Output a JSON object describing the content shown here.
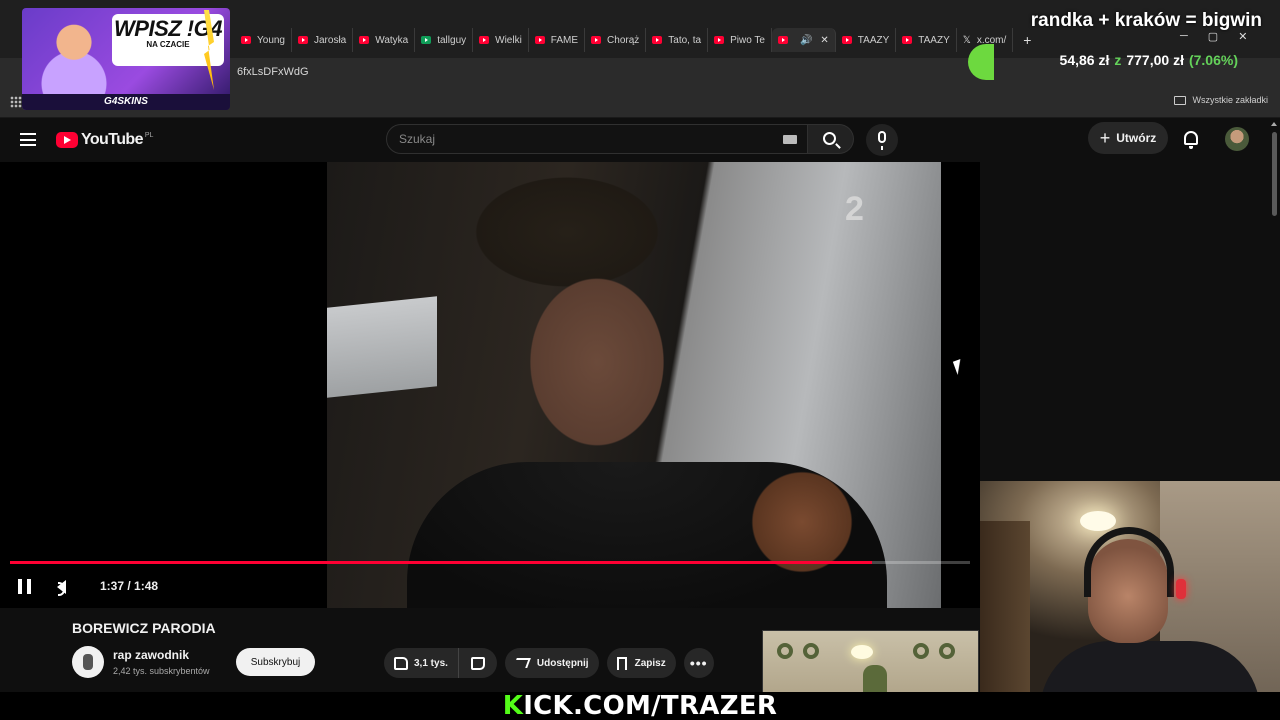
{
  "browser": {
    "tabs": [
      {
        "label": "Young",
        "icon": "youtube-icon"
      },
      {
        "label": "Jarosła",
        "icon": "youtube-icon"
      },
      {
        "label": "Watyka",
        "icon": "youtube-icon"
      },
      {
        "label": "tallguy",
        "icon": "sheets-icon"
      },
      {
        "label": "Wielki",
        "icon": "youtube-icon"
      },
      {
        "label": "FAME",
        "icon": "youtube-icon"
      },
      {
        "label": "Chorąż",
        "icon": "youtube-icon"
      },
      {
        "label": "Tato, ta",
        "icon": "youtube-icon"
      },
      {
        "label": "Piwo Te",
        "icon": "youtube-icon"
      },
      {
        "label": "",
        "icon": "youtube-icon",
        "active": true
      },
      {
        "label": "TAAZY",
        "icon": "youtube-icon"
      },
      {
        "label": "TAAZY",
        "icon": "youtube-icon"
      },
      {
        "label": "x.com/",
        "icon": "x-icon"
      }
    ],
    "url_fragment": "6fxLsDFxWdG",
    "all_bookmarks": "Wszystkie zakładki"
  },
  "promo": {
    "title": "WPISZ !G4",
    "subtitle": "NA CZACIE",
    "brand": "G4SKINS"
  },
  "donation": {
    "title": "randka + kraków = bigwin",
    "current": "54,86 zł",
    "separator": "z",
    "goal": "777,00 zł",
    "percent": "(7.06%)"
  },
  "youtube": {
    "logo_text": "YouTube",
    "region": "PL",
    "search_placeholder": "Szukaj",
    "create_label": "Utwórz"
  },
  "player": {
    "channel_overlay": "2",
    "time": "1:37 / 1:48",
    "progress": 0.898
  },
  "video": {
    "title": "BOREWICZ PARODIA",
    "channel": "rap zawodnik",
    "subscribers": "2,42 tys. subskrybentów",
    "subscribe_label": "Subskrybuj",
    "likes": "3,1 tys.",
    "share_label": "Udostępnij",
    "save_label": "Zapisz"
  },
  "stream": {
    "kick_prefix": "K",
    "kick_rest": "ICK.COM/TRAZER"
  }
}
